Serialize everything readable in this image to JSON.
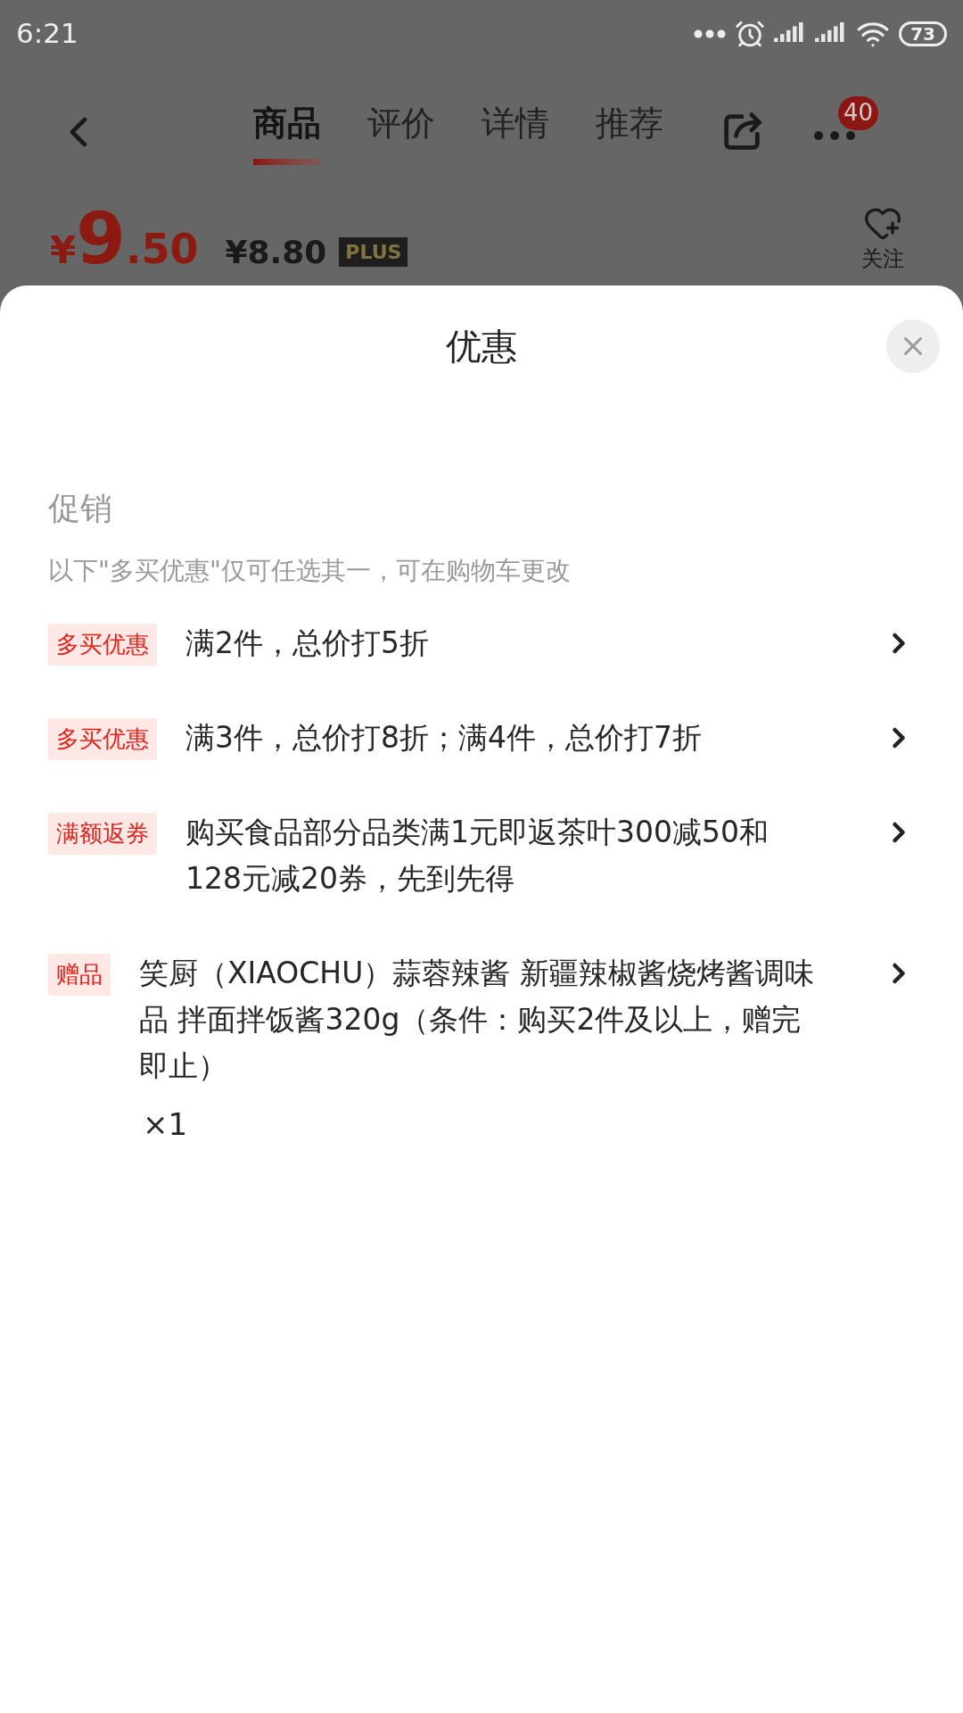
{
  "status_bar": {
    "time": "6:21",
    "battery": "73"
  },
  "nav": {
    "tabs": [
      {
        "label": "商品",
        "selected": true
      },
      {
        "label": "评价",
        "selected": false
      },
      {
        "label": "详情",
        "selected": false
      },
      {
        "label": "推荐",
        "selected": false
      }
    ],
    "more_badge": "40"
  },
  "price": {
    "currency": "¥",
    "integer": "9",
    "decimal": ".50",
    "plus_price": "¥8.80",
    "plus_label": "PLUS",
    "follow": "关注"
  },
  "sheet": {
    "title": "优惠",
    "section": "促销",
    "note": "以下\"多买优惠\"仅可任选其一，可在购物车更改",
    "offers": [
      {
        "tag": "多买优惠",
        "text": "满2件，总价打5折"
      },
      {
        "tag": "多买优惠",
        "text": "满3件，总价打8折；满4件，总价打7折"
      },
      {
        "tag": "满额返券",
        "text": "购买食品部分品类满1元即返茶叶300减50和128元减20券，先到先得"
      },
      {
        "tag": "赠品",
        "text": "笑厨（XIAOCHU）蒜蓉辣酱 新疆辣椒酱烧烤酱调味品 拌面拌饭酱320g（条件：购买2件及以上，赠完即止）",
        "quantity": "×1"
      }
    ]
  }
}
